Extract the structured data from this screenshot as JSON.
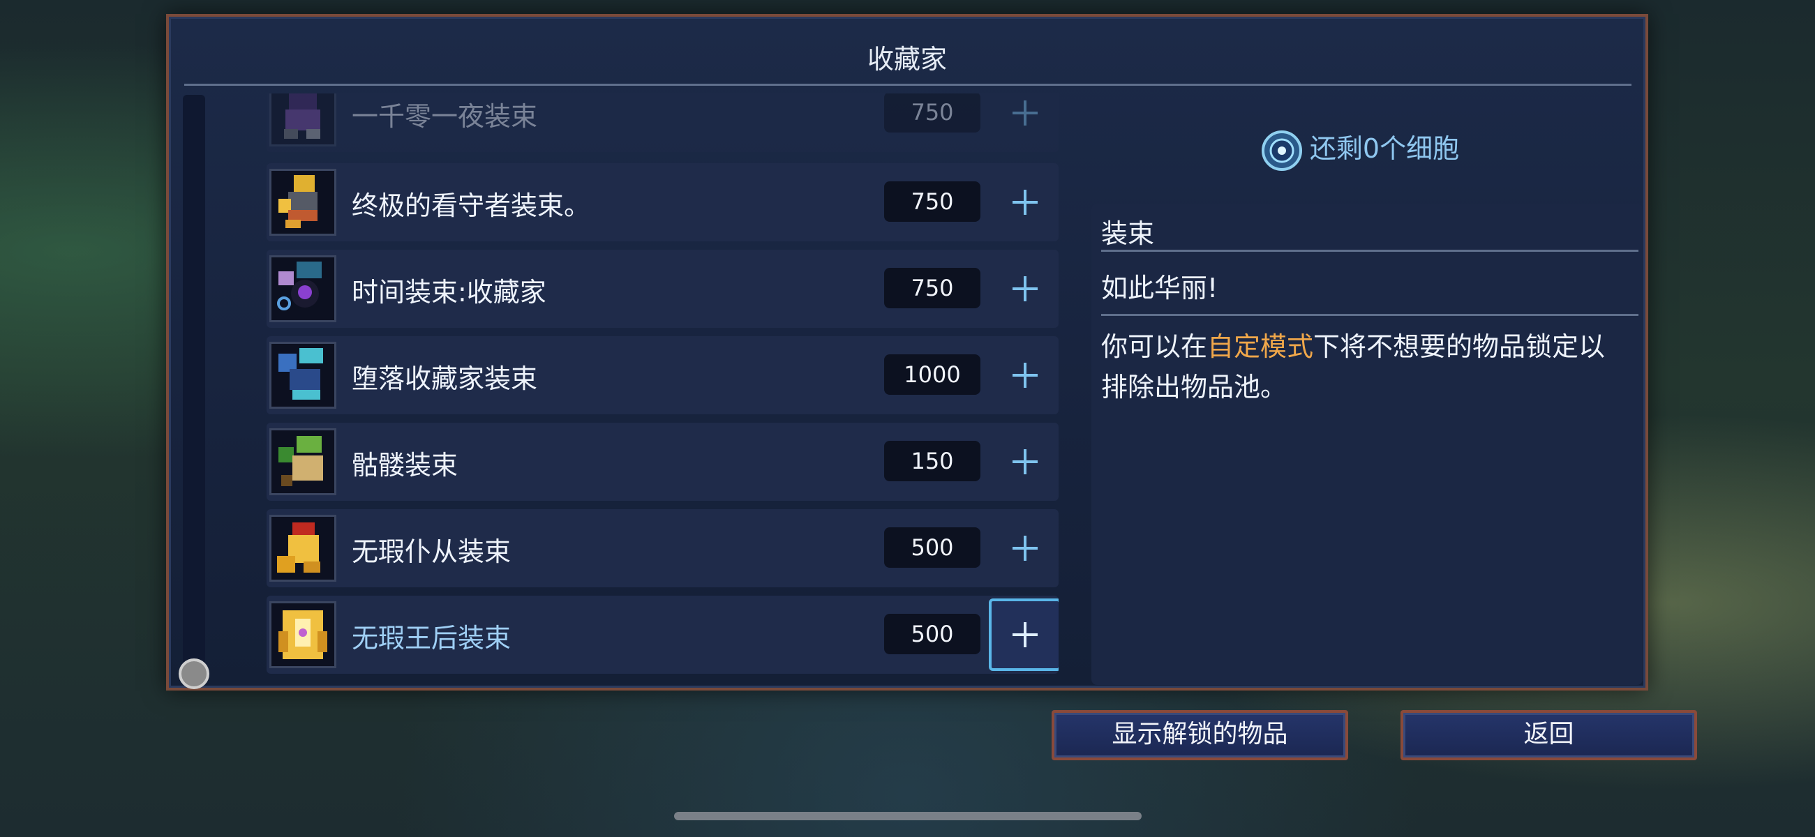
{
  "panel": {
    "title": "收藏家"
  },
  "items": [
    {
      "name": "一千零一夜装束",
      "price": "750",
      "faded": true,
      "selected": false,
      "icon": "outfit-1001-nights-icon"
    },
    {
      "name": "终极的看守者装束。",
      "price": "750",
      "faded": false,
      "selected": false,
      "icon": "outfit-guardian-icon"
    },
    {
      "name": "时间装束:收藏家",
      "price": "750",
      "faded": false,
      "selected": false,
      "icon": "outfit-time-collector-icon"
    },
    {
      "name": "堕落收藏家装束",
      "price": "1000",
      "faded": false,
      "selected": false,
      "icon": "outfit-fallen-collector-icon"
    },
    {
      "name": "骷髅装束",
      "price": "150",
      "faded": false,
      "selected": false,
      "icon": "outfit-skeleton-icon"
    },
    {
      "name": "无瑕仆从装束",
      "price": "500",
      "faded": false,
      "selected": false,
      "icon": "outfit-servant-icon"
    },
    {
      "name": "无瑕王后装束",
      "price": "500",
      "faded": false,
      "selected": true,
      "icon": "outfit-queen-icon"
    }
  ],
  "cells": {
    "text": "还剩0个细胞",
    "icon": "cell-icon"
  },
  "detail": {
    "header": "装束",
    "quote": "如此华丽!",
    "desc_before": "你可以在",
    "desc_highlight": "自定模式",
    "desc_after": "下将不想要的物品锁定以排除出物品池。"
  },
  "buttons": {
    "show_unlocked": "显示解锁的物品",
    "back": "返回"
  },
  "colors": {
    "highlight": "#f0a74a",
    "selected_border": "#5ab6e8",
    "panel_border": "#7a4a3a"
  }
}
